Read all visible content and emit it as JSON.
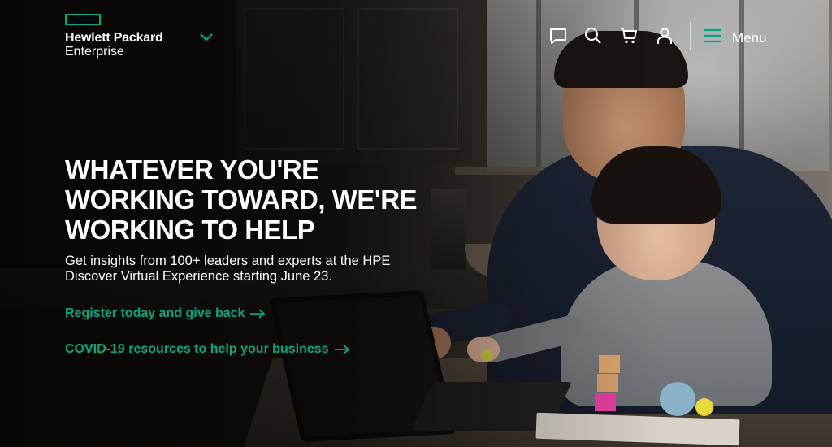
{
  "brand": {
    "logo_line1": "Hewlett Packard",
    "logo_line2": "Enterprise",
    "accent_color": "#01a982"
  },
  "header": {
    "icons": [
      "chat-icon",
      "search-icon",
      "cart-icon",
      "user-icon",
      "hamburger-icon",
      "chevron-down-icon"
    ],
    "menu_label": "Menu"
  },
  "hero": {
    "headline": "WHATEVER YOU'RE WORKING TOWARD, WE'RE WORKING TO HELP",
    "subtext": "Get insights from 100+ leaders and experts at the HPE Discover Virtual Experience starting June 23.",
    "links": [
      {
        "label": "Register today and give back"
      },
      {
        "label": "COVID-19 resources to help your business"
      }
    ]
  }
}
